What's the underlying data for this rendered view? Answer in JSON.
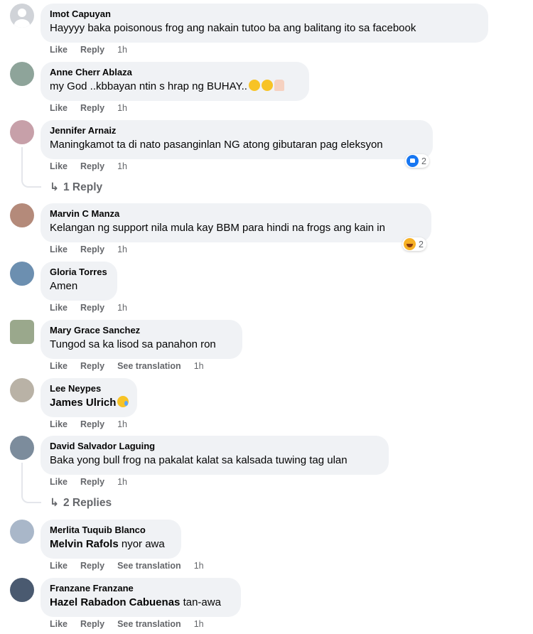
{
  "action_labels": {
    "like": "Like",
    "reply": "Reply",
    "see_translation": "See translation"
  },
  "comments": [
    {
      "author": "Imot Capuyan",
      "text": "Hayyyy baka poisonous frog ang nakain tutoo ba ang balitang ito sa facebook",
      "time": "1h",
      "avatar_color": "#bfc3c8"
    },
    {
      "author": "Anne Cherr Ablaza",
      "text": "my God ..kbbayan ntin s hrap ng BUHAY..",
      "time": "1h",
      "avatar_color": "#8ea49a"
    },
    {
      "author": "Jennifer Arnaiz",
      "text": "Maningkamot ta di nato pasanginlan NG atong gibutaran pag eleksyon",
      "time": "1h",
      "avatar_color": "#c7a0a9",
      "reaction": {
        "icon": "like-icon",
        "count": "2"
      },
      "replies_label": "1 Reply"
    },
    {
      "author": "Marvin C Manza",
      "text": "Kelangan ng support nila mula kay BBM para hindi na frogs ang kain in",
      "time": "1h",
      "avatar_color": "#b48a7a",
      "reaction": {
        "icon": "haha-icon",
        "count": "2"
      }
    },
    {
      "author": "Gloria Torres",
      "text": "Amen",
      "time": "1h",
      "avatar_color": "#6c8fb0"
    },
    {
      "author": "Mary Grace Sanchez",
      "text": "Tungod sa ka lisod sa panahon ron",
      "time": "1h",
      "avatar_color": "#9aa88c"
    },
    {
      "author": "Lee Neypes",
      "mention": "James Ulrich",
      "text": "",
      "time": "1h",
      "avatar_color": "#b9b2a6"
    },
    {
      "author": "David Salvador Laguing",
      "text": "Baka yong bull frog na pakalat kalat sa kalsada tuwing tag ulan",
      "time": "1h",
      "avatar_color": "#7c8c9c",
      "replies_label": "2 Replies"
    },
    {
      "author": "Merlita Tuquib Blanco",
      "mention": "Melvin Rafols",
      "text": "nyor awa",
      "time": "1h",
      "avatar_color": "#a9b7c9"
    },
    {
      "author": "Franzane Franzane",
      "mention": "Hazel Rabadon Cabuenas",
      "text": "tan-awa",
      "time": "1h",
      "avatar_color": "#4a5a70"
    }
  ]
}
